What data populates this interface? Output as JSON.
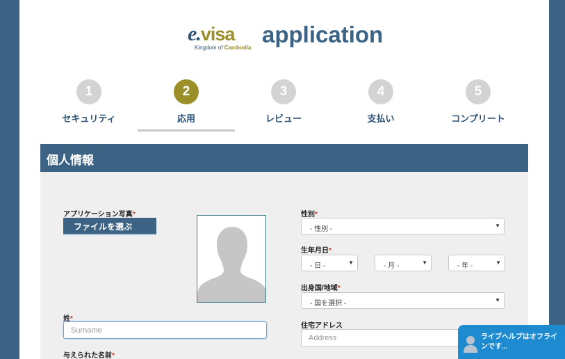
{
  "header": {
    "logo_mark": "e.",
    "logo_mark_visa": "visa",
    "logo_sub_prefix": "Kingdom of ",
    "logo_sub_brand": "Cambodia",
    "title": "application"
  },
  "steps": [
    {
      "number": "1",
      "label": "セキュリティ",
      "active": false
    },
    {
      "number": "2",
      "label": "応用",
      "active": true
    },
    {
      "number": "3",
      "label": "レビュー",
      "active": false
    },
    {
      "number": "4",
      "label": "支払い",
      "active": false
    },
    {
      "number": "5",
      "label": "コンプリート",
      "active": false
    }
  ],
  "section": {
    "title": "個人情報"
  },
  "form": {
    "photo_label": "アプリケーション写真",
    "file_button": "ファイルを選ぶ",
    "surname_label": "姓",
    "surname_placeholder": "Surname",
    "given_name_label": "与えられた名前",
    "gender_label": "性別",
    "gender_value": "- 性別 -",
    "dob_label": "生年月日",
    "dob_day": "- 日 -",
    "dob_month": "- 月 -",
    "dob_year": "- 年 -",
    "country_label": "出身国/地域",
    "country_value": "- 国を選択 -",
    "address_label": "住宅アドレス",
    "address_placeholder": "Address",
    "required_mark": "*"
  },
  "chat": {
    "text": "ライブヘルプはオフラインです..."
  },
  "colors": {
    "brand_blue": "#3c6384",
    "accent_gold": "#9b8f2a",
    "chat_blue": "#1e8bd1"
  }
}
